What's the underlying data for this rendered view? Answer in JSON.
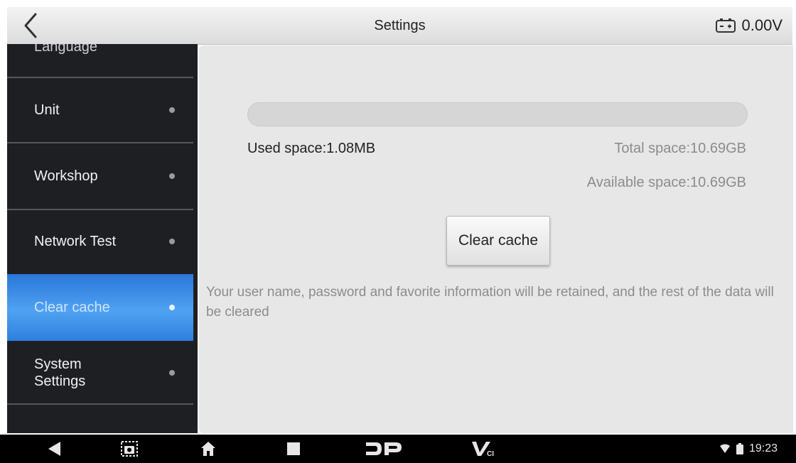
{
  "header": {
    "title": "Settings",
    "voltage": "0.00V"
  },
  "sidebar": {
    "items": [
      {
        "label": "Language",
        "active": false
      },
      {
        "label": "Unit",
        "active": false
      },
      {
        "label": "Workshop",
        "active": false
      },
      {
        "label": "Network Test",
        "active": false
      },
      {
        "label": "Clear cache",
        "active": true
      },
      {
        "label": "System Settings",
        "active": false
      }
    ]
  },
  "storage": {
    "used_label": "Used space:1.08MB",
    "total_label": "Total space:10.69GB",
    "available_label": "Available space:10.69GB",
    "used_fraction": 0.0001
  },
  "actions": {
    "clear_cache_label": "Clear cache"
  },
  "note": "Your user name, password and favorite information will be retained, and the rest of the data will be cleared",
  "navbar": {
    "time": "19:23",
    "brand_mark": "VCI"
  },
  "colors": {
    "accent": "#3d8ee6",
    "sidebar_bg": "#1e1f23",
    "content_bg": "#e7e7e7"
  }
}
